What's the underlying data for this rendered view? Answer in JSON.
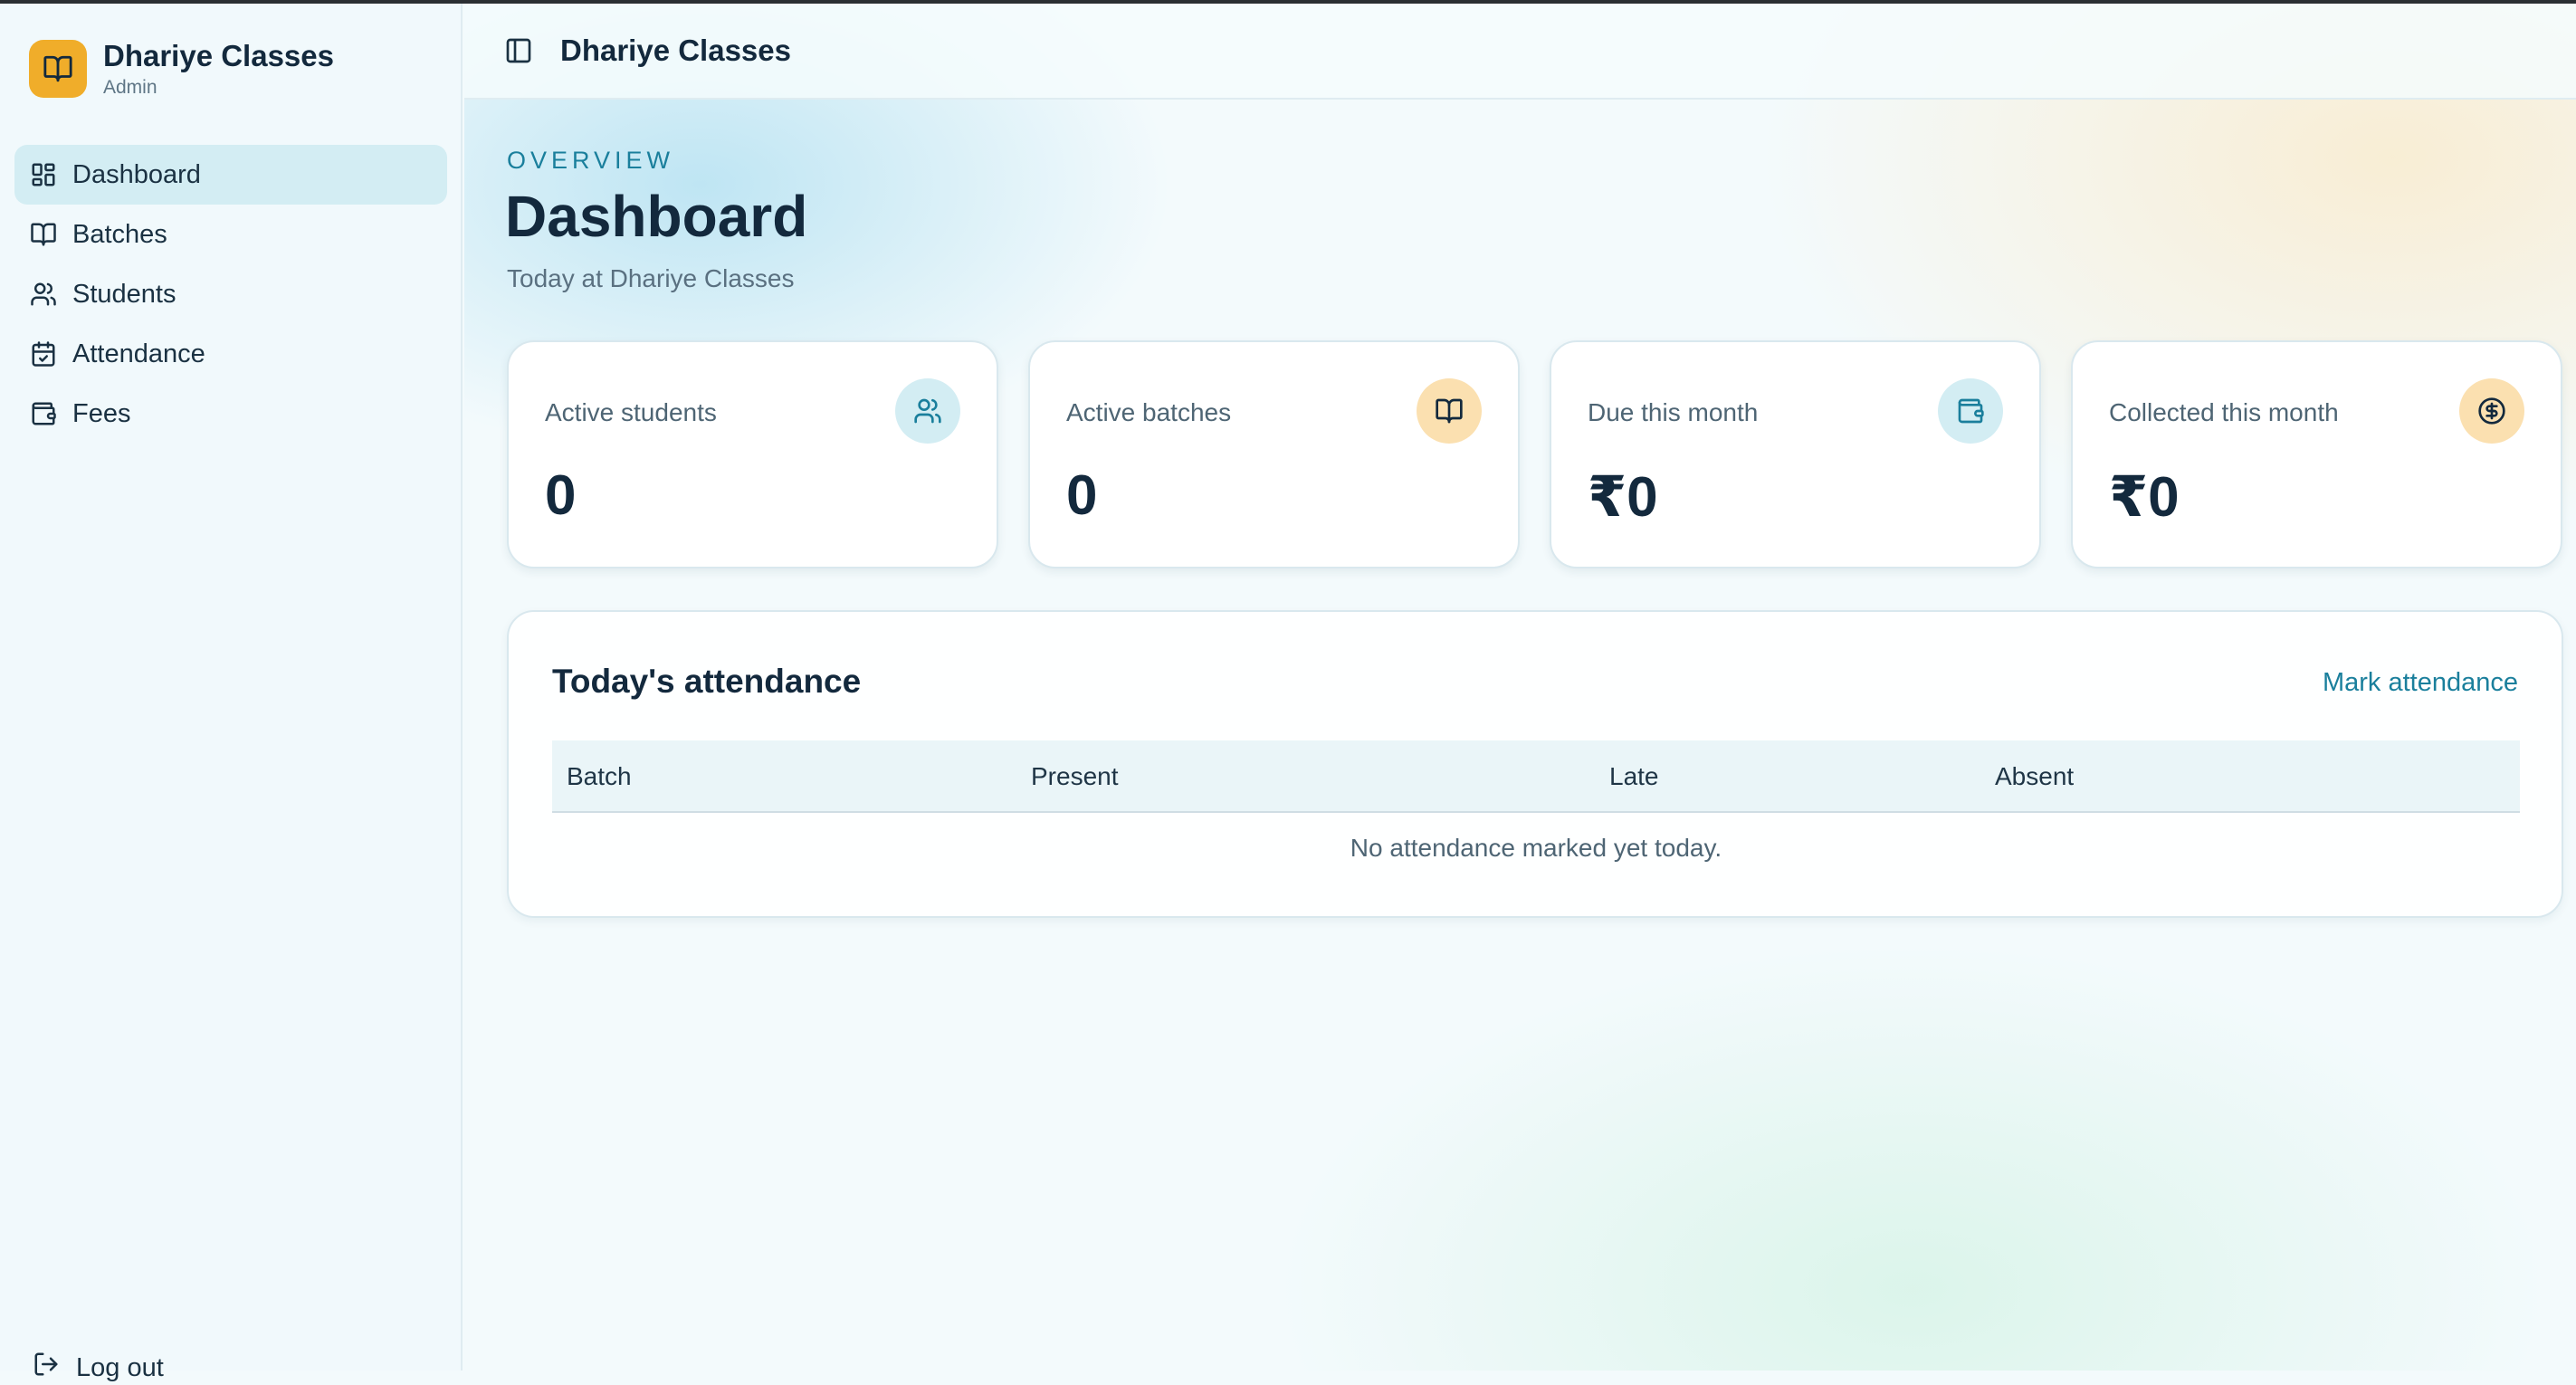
{
  "sidebar": {
    "brand_name": "Dhariye Classes",
    "brand_role": "Admin",
    "items": [
      {
        "label": "Dashboard",
        "icon": "dashboard-grid-icon",
        "active": true
      },
      {
        "label": "Batches",
        "icon": "book-icon"
      },
      {
        "label": "Students",
        "icon": "users-icon"
      },
      {
        "label": "Attendance",
        "icon": "calendar-check-icon"
      },
      {
        "label": "Fees",
        "icon": "wallet-icon"
      }
    ],
    "logout_label": "Log out"
  },
  "header": {
    "title": "Dhariye Classes"
  },
  "page": {
    "eyebrow": "OVERVIEW",
    "title": "Dashboard",
    "subtitle": "Today at Dhariye Classes"
  },
  "stats": [
    {
      "label": "Active students",
      "value": "0",
      "icon": "users-icon"
    },
    {
      "label": "Active batches",
      "value": "0",
      "icon": "book-icon"
    },
    {
      "label": "Due this month",
      "value": "₹0",
      "icon": "wallet-icon"
    },
    {
      "label": "Collected this month",
      "value": "₹0",
      "icon": "dollar-circle-icon"
    }
  ],
  "attendance": {
    "title": "Today's attendance",
    "action_label": "Mark attendance",
    "columns": [
      "Batch",
      "Present",
      "Late",
      "Absent"
    ],
    "empty_message": "No attendance marked yet today."
  },
  "colors": {
    "accent": "#1a7f9c",
    "brand": "#f0ad2a",
    "text": "#13293d",
    "active_nav": "#d3edf3"
  }
}
